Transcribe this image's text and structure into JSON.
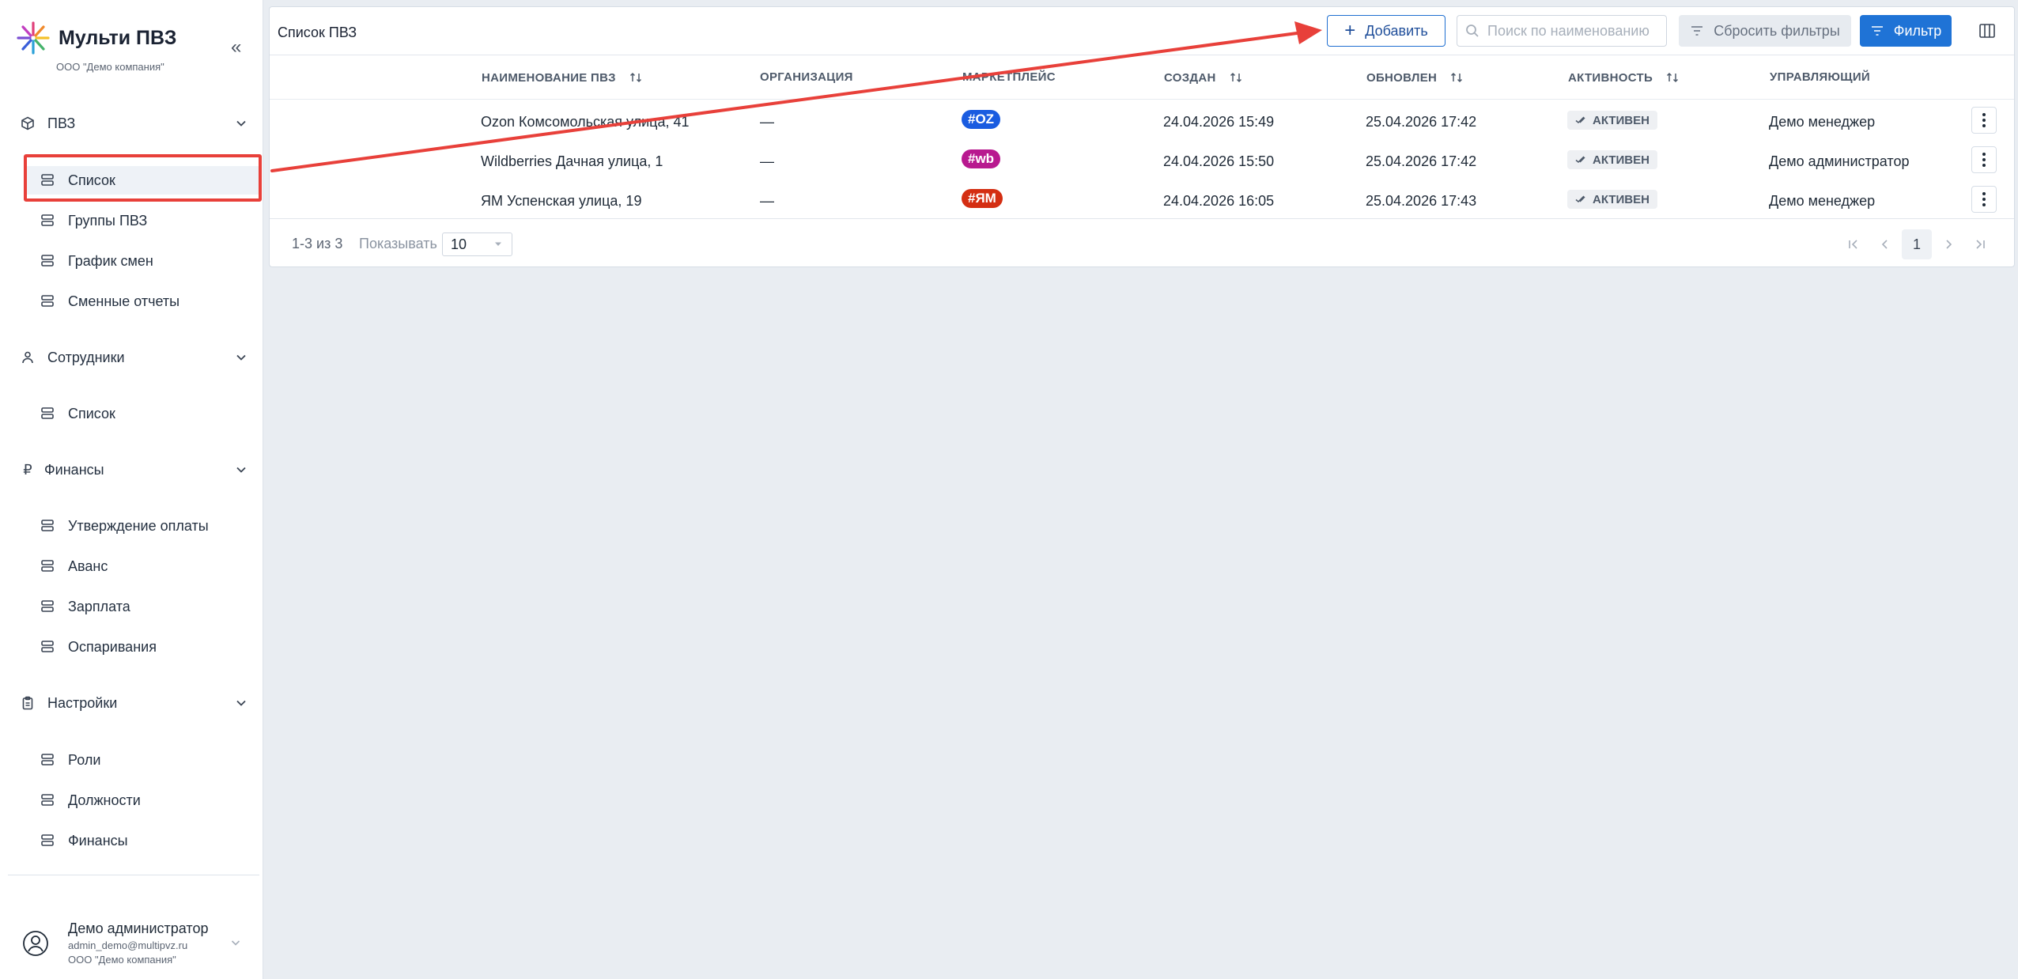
{
  "brand": {
    "title": "Мульти ПВЗ",
    "subtitle": "ООО \"Демо компания\""
  },
  "sidebar": {
    "collapse_icon": "double-chevron-left-icon",
    "sections": [
      {
        "label": "ПВЗ",
        "icon": "cube-icon",
        "items": [
          "Список",
          "Группы ПВЗ",
          "График смен",
          "Сменные отчеты"
        ]
      },
      {
        "label": "Сотрудники",
        "icon": "person-icon",
        "items": [
          "Список"
        ]
      },
      {
        "label": "Финансы",
        "icon": "ruble-icon",
        "items": [
          "Утверждение оплаты",
          "Аванс",
          "Зарплата",
          "Оспаривания"
        ]
      },
      {
        "label": "Настройки",
        "icon": "clipboard-icon",
        "items": [
          "Роли",
          "Должности",
          "Финансы"
        ]
      }
    ],
    "active_item": "Список"
  },
  "user": {
    "name": "Демо администратор",
    "email": "admin_demo@multipvz.ru",
    "org": "ООО \"Демо компания\""
  },
  "page": {
    "title": "Список ПВЗ",
    "add_label": "Добавить",
    "search_placeholder": "Поиск по наименованию",
    "reset_label": "Сбросить фильтры",
    "filter_label": "Фильтр"
  },
  "table": {
    "columns": [
      "НАИМЕНОВАНИЕ ПВЗ",
      "ОРГАНИЗАЦИЯ",
      "МАРКЕТПЛЕЙС",
      "СОЗДАН",
      "ОБНОВЛЕН",
      "АКТИВНОСТЬ",
      "УПРАВЛЯЮЩИЙ"
    ],
    "rows": [
      {
        "name": "Ozon Комсомольская улица, 41",
        "org": "—",
        "marketplace": "#OZ",
        "mp_color": "#1a5ce0",
        "created": "24.04.2026 15:49",
        "updated": "25.04.2026 17:42",
        "status": "АКТИВЕН",
        "manager": "Демо менеджер"
      },
      {
        "name": "Wildberries Дачная улица, 1",
        "org": "—",
        "marketplace": "#wb",
        "mp_color": "#b8198f",
        "created": "24.04.2026 15:50",
        "updated": "25.04.2026 17:42",
        "status": "АКТИВЕН",
        "manager": "Демо администратор"
      },
      {
        "name": "ЯМ Успенская улица, 19",
        "org": "—",
        "marketplace": "#ЯМ",
        "mp_color": "#d42e12",
        "created": "24.04.2026 16:05",
        "updated": "25.04.2026 17:43",
        "status": "АКТИВЕН",
        "manager": "Демо менеджер"
      }
    ]
  },
  "pagination": {
    "range": "1-3 из 3",
    "show_label": "Показывать",
    "page_size": "10",
    "current_page": "1"
  },
  "colors": {
    "accent": "#1f73d6",
    "annotation": "#e8403a"
  }
}
